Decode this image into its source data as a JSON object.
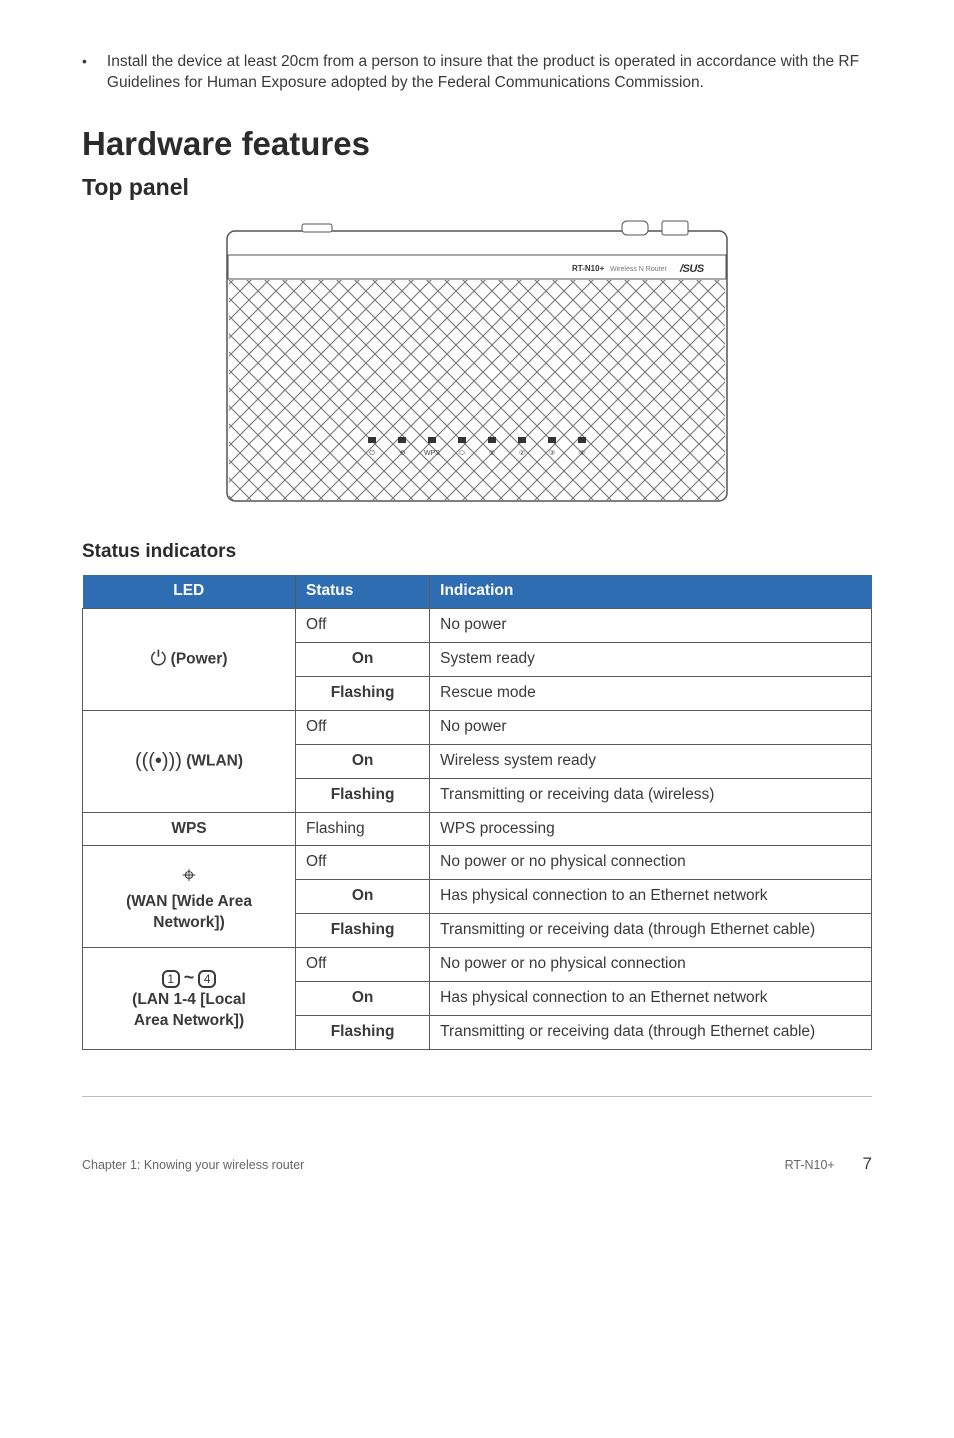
{
  "intro_bullet": "Install the device at least 20cm from a person to insure that the product is operated in accordance with the RF Guidelines for Human Exposure adopted by the Federal Communications Commission.",
  "h1": "Hardware features",
  "h2": "Top panel",
  "router_label": "RT-N10+",
  "router_sublabel": "Wireless N Router",
  "h3": "Status indicators",
  "thead": {
    "c1": "LED",
    "c2": "Status",
    "c3": "Indication"
  },
  "rows": {
    "power": {
      "label": "(Power)",
      "r1s": "Off",
      "r1i": "No power",
      "r2s": "On",
      "r2i": "System ready",
      "r3s": "Flashing",
      "r3i": "Rescue mode"
    },
    "wlan": {
      "label": "(WLAN)",
      "r1s": "Off",
      "r1i": "No power",
      "r2s": "On",
      "r2i": "Wireless system ready",
      "r3s": "Flashing",
      "r3i": "Transmitting or receiving data (wireless)"
    },
    "wps": {
      "label": "WPS",
      "s": "Flashing",
      "i": "WPS processing"
    },
    "wan": {
      "label1": "(WAN [Wide Area",
      "label2": "Network])",
      "r1s": "Off",
      "r1i": "No power or no physical connection",
      "r2s": "On",
      "r2i": "Has physical connection to an Ethernet network",
      "r3s": "Flashing",
      "r3i": "Transmitting or receiving data (through Ethernet cable)"
    },
    "lan": {
      "label1": "(LAN 1-4 [Local",
      "label2": "Area Network])",
      "r1s": "Off",
      "r1i": "No power or no physical connection",
      "r2s": "On",
      "r2i": "Has physical connection to an Ethernet network",
      "r3s": "Flashing",
      "r3i": "Transmitting or receiving data (through Ethernet cable)"
    }
  },
  "footer": {
    "left": "Chapter 1: Knowing your wireless router",
    "mid": "RT-N10+",
    "page": "7"
  }
}
